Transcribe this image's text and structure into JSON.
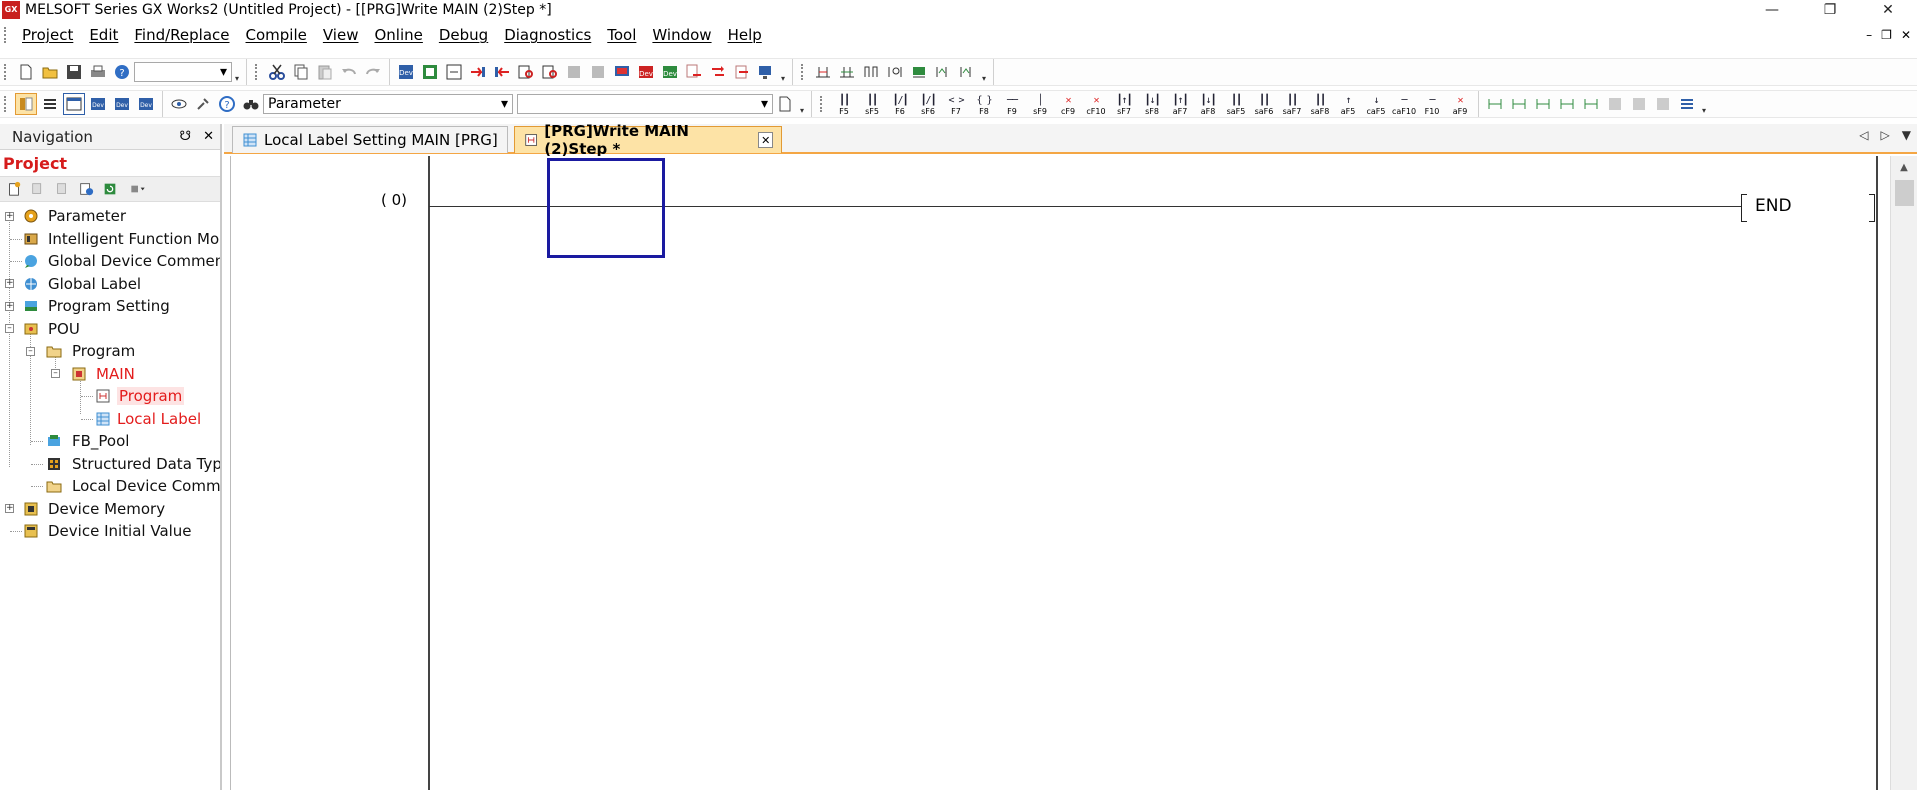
{
  "window": {
    "title": "MELSOFT Series GX Works2 (Untitled Project) - [[PRG]Write MAIN (2)Step *]",
    "app_icon_text": "GX"
  },
  "menu": [
    {
      "label": "Project"
    },
    {
      "label": "Edit"
    },
    {
      "label": "Find/Replace"
    },
    {
      "label": "Compile"
    },
    {
      "label": "View"
    },
    {
      "label": "Online"
    },
    {
      "label": "Debug"
    },
    {
      "label": "Diagnostics"
    },
    {
      "label": "Tool"
    },
    {
      "label": "Window"
    },
    {
      "label": "Help"
    }
  ],
  "toolbar2": {
    "parameter_select": "Parameter"
  },
  "fkeys": [
    "F5",
    "sF5",
    "F6",
    "sF6",
    "F7",
    "F8",
    "F9",
    "sF9",
    "cF9",
    "cF10",
    "sF7",
    "sF8",
    "aF7",
    "aF8",
    "saF5",
    "saF6",
    "saF7",
    "saF8",
    "aF5",
    "caF5",
    "caF10",
    "F10",
    "aF9"
  ],
  "navigation": {
    "header": "Navigation",
    "section": "Project",
    "tree": [
      {
        "label": "Parameter"
      },
      {
        "label": "Intelligent Function Module"
      },
      {
        "label": "Global Device Comment"
      },
      {
        "label": "Global Label"
      },
      {
        "label": "Program Setting"
      },
      {
        "label": "POU"
      },
      {
        "label": "Program"
      },
      {
        "label": "MAIN"
      },
      {
        "label": "Program"
      },
      {
        "label": "Local Label"
      },
      {
        "label": "FB_Pool"
      },
      {
        "label": "Structured Data Types"
      },
      {
        "label": "Local Device Comment"
      },
      {
        "label": "Device Memory"
      },
      {
        "label": "Device Initial Value"
      }
    ]
  },
  "tabs": [
    {
      "label": "Local Label Setting MAIN [PRG]"
    },
    {
      "label": "[PRG]Write MAIN (2)Step *"
    }
  ],
  "ladder": {
    "step_label": "(    0)",
    "end_instruction": "END"
  },
  "colors": {
    "accent_tab": "#fde3a6",
    "tab_border": "#f4a644",
    "tree_red": "#e31c1c",
    "cursor": "#1a1aa0"
  }
}
